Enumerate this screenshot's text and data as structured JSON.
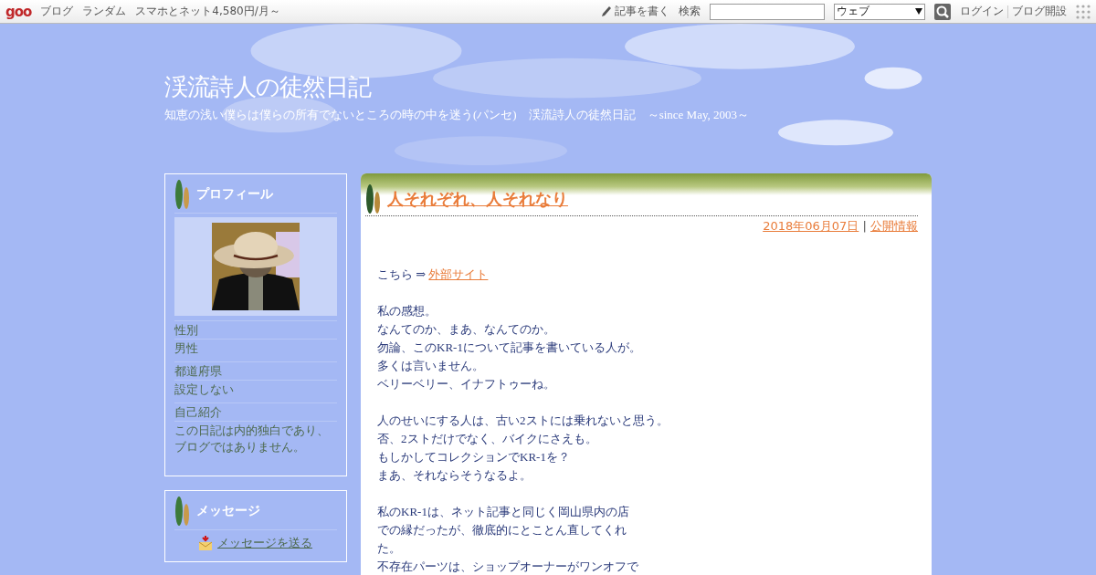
{
  "topbar": {
    "logo": "goo",
    "links": [
      "ブログ",
      "ランダム",
      "スマホとネット4,580円/月～"
    ],
    "write": "記事を書く",
    "search_label": "検索",
    "search_scope": "ウェブ",
    "login": "ログイン",
    "signup": "ブログ開設"
  },
  "header": {
    "title": "渓流詩人の徒然日記",
    "tagline": "知恵の浅い僕らは僕らの所有でないところの時の中を迷う(パンセ)　渓流詩人の徒然日記　～since May, 2003～"
  },
  "profile": {
    "title": "プロフィール",
    "fields": [
      {
        "label": "性別",
        "value": [
          "男性"
        ]
      },
      {
        "label": "都道府県",
        "value": [
          "設定しない"
        ]
      },
      {
        "label": "自己紹介",
        "value": [
          "この日記は内的独白であり、",
          "ブログではありません。"
        ]
      }
    ]
  },
  "message": {
    "title": "メッセージ",
    "link": "メッセージを送る"
  },
  "entry": {
    "title": "人それぞれ、人それなり",
    "date": "2018年06月07日",
    "sep": "|",
    "category": "公開情報",
    "intro": "こちら ⇒",
    "intro_link": "外部サイト",
    "paragraphs": [
      [
        "私の感想。",
        "なんてのか、まあ、なんてのか。",
        "勿論、このKR-1について記事を書いている人が。",
        "多くは言いません。",
        "ベリーベリー、イナフトゥーね。"
      ],
      [
        "人のせいにする人は、古い2ストには乗れないと思う。",
        "否、2ストだけでなく、バイクにさえも。",
        "もしかしてコレクションでKR-1を？",
        "まあ、それならそうなるよ。"
      ],
      [
        "私のKR-1は、ネット記事と同じく岡山県内の店",
        "での縁だったが、徹底的にとことん直してくれ",
        "た。",
        "不存在パーツは、ショップオーナーがワンオフで"
      ]
    ]
  }
}
